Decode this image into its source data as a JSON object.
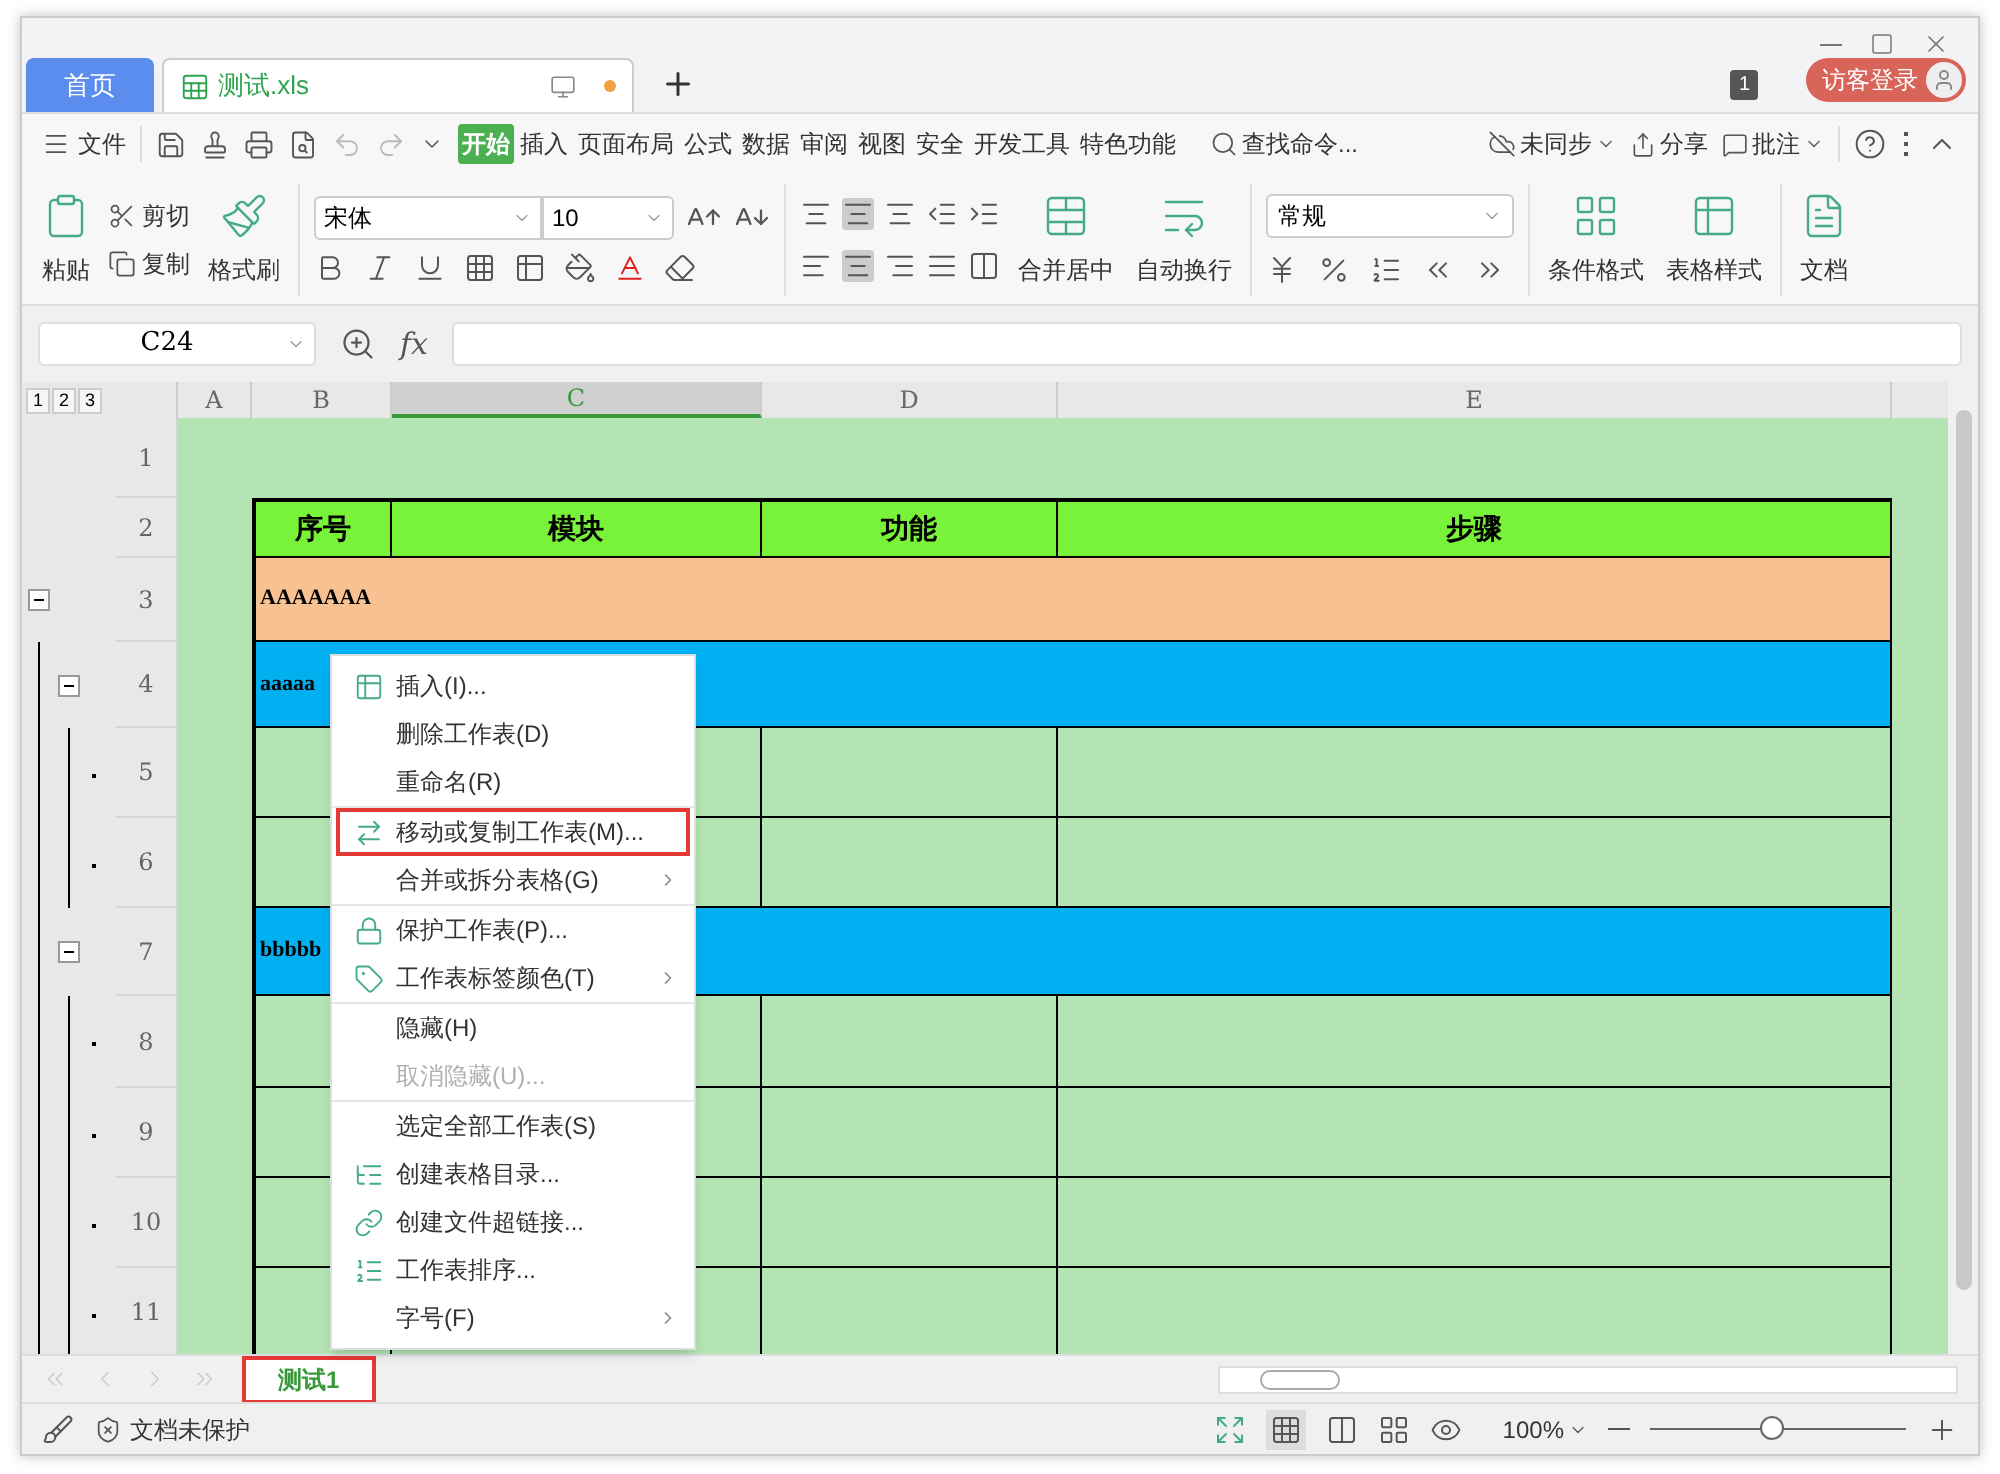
{
  "tabs": [
    {
      "label": "首页",
      "kind": "home",
      "selected": false
    },
    {
      "label": "测试.xls",
      "kind": "file",
      "selected": true
    }
  ],
  "window_badge": "1",
  "login_button": "访客登录",
  "menu": {
    "file": "文件",
    "tabs": [
      {
        "label": "开始",
        "selected": true
      },
      {
        "label": "插入",
        "selected": false
      },
      {
        "label": "页面布局",
        "selected": false
      },
      {
        "label": "公式",
        "selected": false
      },
      {
        "label": "数据",
        "selected": false
      },
      {
        "label": "审阅",
        "selected": false
      },
      {
        "label": "视图",
        "selected": false
      },
      {
        "label": "安全",
        "selected": false
      },
      {
        "label": "开发工具",
        "selected": false
      },
      {
        "label": "特色功能",
        "selected": false
      }
    ],
    "search": "查找命令...",
    "sync": "未同步",
    "share": "分享",
    "comment": "批注"
  },
  "ribbon": {
    "paste": "粘贴",
    "cut": "剪切",
    "copy": "复制",
    "format_painter": "格式刷",
    "font": "宋体",
    "font_size": "10",
    "merge": "合并居中",
    "wrap": "自动换行",
    "number_format": "常规",
    "conditional_format": "条件格式",
    "table_style": "表格样式",
    "doc": "文档"
  },
  "name_box": "C24",
  "formula_label": "fx",
  "outline_levels": [
    "1",
    "2",
    "3"
  ],
  "columns": [
    {
      "label": "A",
      "selected": false
    },
    {
      "label": "B",
      "selected": false
    },
    {
      "label": "C",
      "selected": true
    },
    {
      "label": "D",
      "selected": false
    },
    {
      "label": "E",
      "selected": false
    }
  ],
  "rows": [
    {
      "number": "1",
      "kind": "empty"
    },
    {
      "number": "2",
      "kind": "header",
      "cells": [
        "序号",
        "模块",
        "功能",
        "步骤"
      ]
    },
    {
      "number": "3",
      "kind": "group",
      "text": "AAAAAAA",
      "color": "#f8c192",
      "expanded": true,
      "children": [
        {
          "number": "4",
          "kind": "group",
          "text": "aaaaa",
          "color": "#00b0f0",
          "expanded": true,
          "children": [
            {
              "number": "5",
              "kind": "data"
            },
            {
              "number": "6",
              "kind": "data"
            }
          ]
        },
        {
          "number": "7",
          "kind": "group",
          "text": "bbbbb",
          "color": "#00b0f0",
          "expanded": true,
          "children": [
            {
              "number": "8",
              "kind": "data"
            },
            {
              "number": "9",
              "kind": "data"
            },
            {
              "number": "10",
              "kind": "data"
            },
            {
              "number": "11",
              "kind": "data"
            }
          ]
        }
      ]
    }
  ],
  "context_menu": [
    {
      "label": "插入(I)...",
      "kind": "insert",
      "separator": false,
      "submenu": false,
      "disabled": false,
      "highlighted": false
    },
    {
      "label": "删除工作表(D)",
      "kind": "plain",
      "separator": false,
      "submenu": false,
      "disabled": false,
      "highlighted": false
    },
    {
      "label": "重命名(R)",
      "kind": "plain",
      "separator": false,
      "submenu": false,
      "disabled": false,
      "highlighted": false
    },
    {
      "label": "移动或复制工作表(M)...",
      "kind": "move",
      "separator": true,
      "submenu": false,
      "disabled": false,
      "highlighted": true
    },
    {
      "label": "合并或拆分表格(G)",
      "kind": "plain",
      "separator": false,
      "submenu": true,
      "disabled": false,
      "highlighted": false
    },
    {
      "label": "保护工作表(P)...",
      "kind": "protect",
      "separator": true,
      "submenu": false,
      "disabled": false,
      "highlighted": false
    },
    {
      "label": "工作表标签颜色(T)",
      "kind": "tab_color",
      "separator": false,
      "submenu": true,
      "disabled": false,
      "highlighted": false
    },
    {
      "label": "隐藏(H)",
      "kind": "plain",
      "separator": true,
      "submenu": false,
      "disabled": false,
      "highlighted": false
    },
    {
      "label": "取消隐藏(U)...",
      "kind": "plain",
      "separator": false,
      "submenu": false,
      "disabled": true,
      "highlighted": false
    },
    {
      "label": "选定全部工作表(S)",
      "kind": "plain",
      "separator": true,
      "submenu": false,
      "disabled": false,
      "highlighted": false
    },
    {
      "label": "创建表格目录...",
      "kind": "toc",
      "separator": false,
      "submenu": false,
      "disabled": false,
      "highlighted": false
    },
    {
      "label": "创建文件超链接...",
      "kind": "hyperlink",
      "separator": false,
      "submenu": false,
      "disabled": false,
      "highlighted": false
    },
    {
      "label": "工作表排序...",
      "kind": "sort",
      "separator": false,
      "submenu": false,
      "disabled": false,
      "highlighted": false
    },
    {
      "label": "字号(F)",
      "kind": "plain",
      "separator": false,
      "submenu": true,
      "disabled": false,
      "highlighted": false
    }
  ],
  "sheet_tabs": [
    {
      "label": "测试1",
      "selected": true,
      "highlighted": true
    }
  ],
  "status_bar": {
    "protection": "文档未保护",
    "zoom": "100%"
  },
  "zoom": {
    "level": 0.48
  }
}
